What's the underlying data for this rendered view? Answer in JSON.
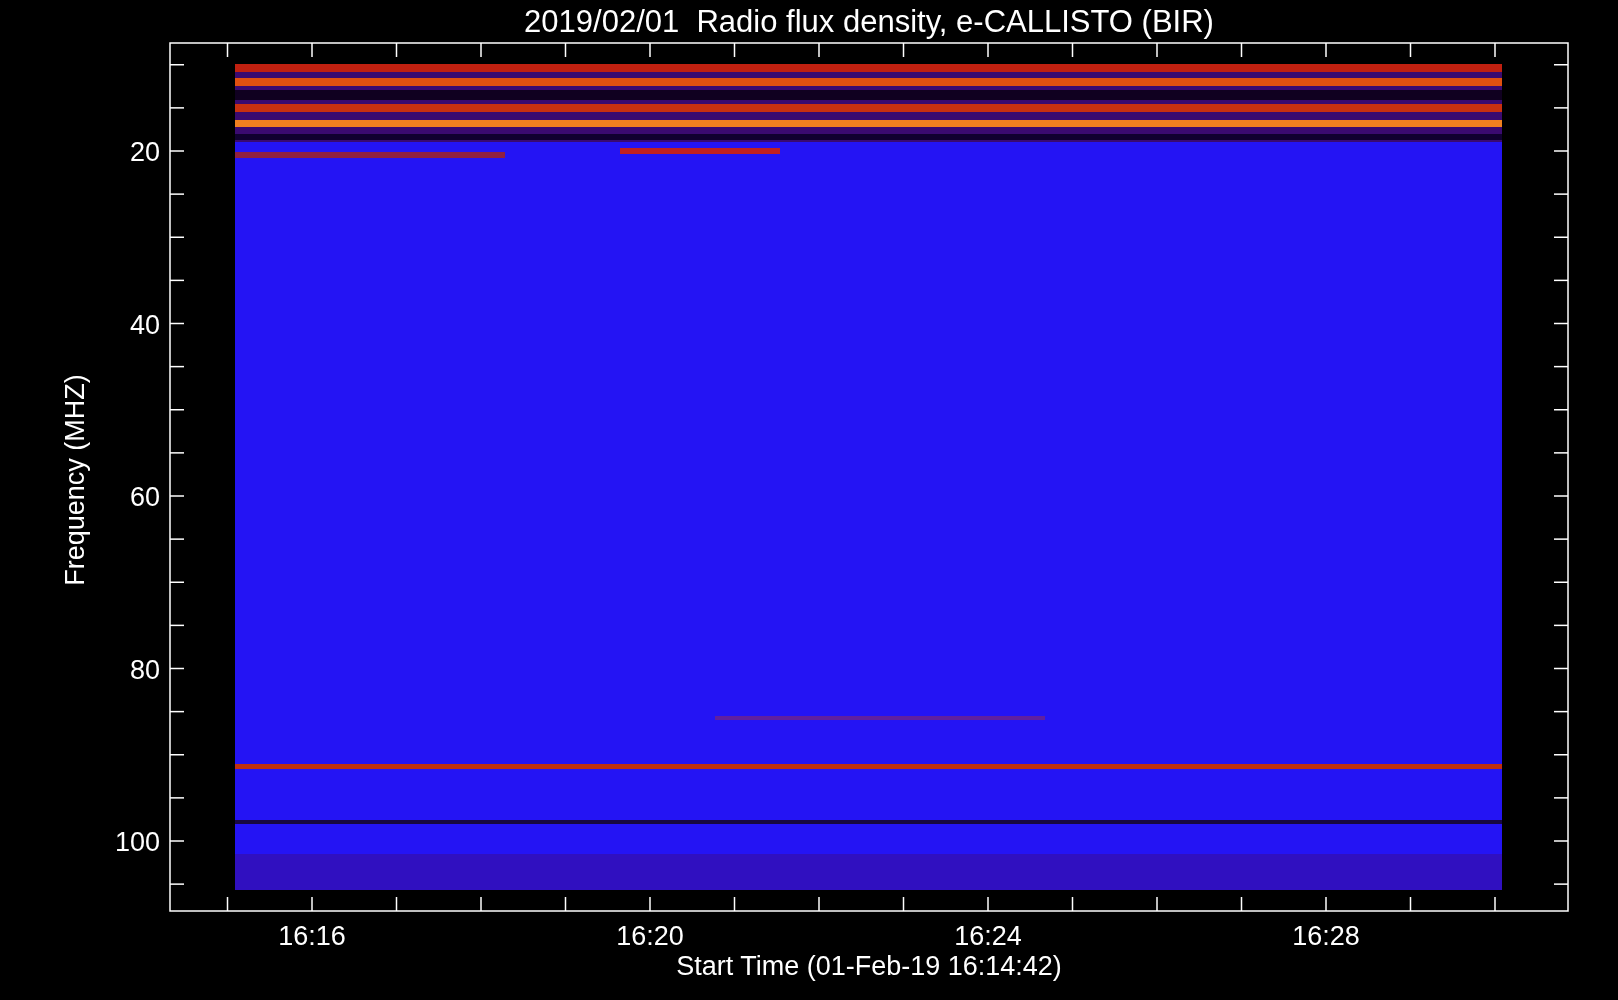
{
  "title": "2019/02/01  Radio flux density, e-CALLISTO (BIR)",
  "y_axis": {
    "label": "Frequency (MHZ)",
    "ticks": [
      "20",
      "40",
      "60",
      "80",
      "100"
    ]
  },
  "x_axis": {
    "label": "Start Time (01-Feb-19 16:14:42)",
    "ticks": [
      "16:16",
      "16:20",
      "16:24",
      "16:28"
    ]
  }
}
